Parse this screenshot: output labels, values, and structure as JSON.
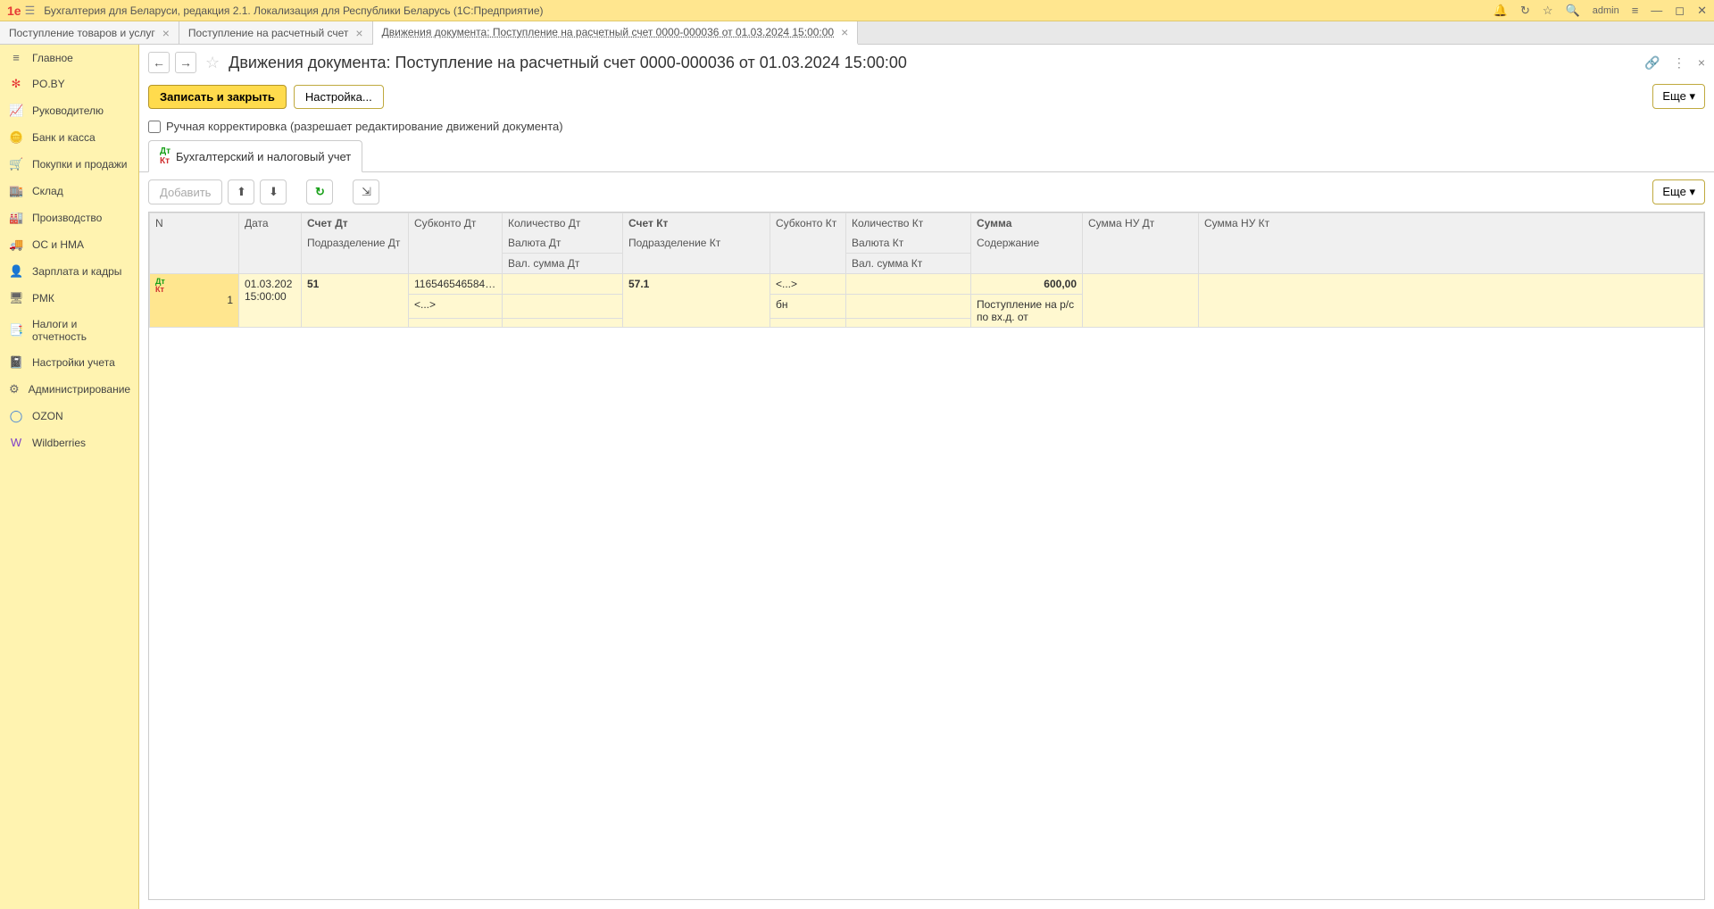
{
  "titlebar": {
    "title": "Бухгалтерия для Беларуси, редакция 2.1. Локализация для Республики Беларусь   (1С:Предприятие)",
    "user": "admin"
  },
  "tabs": [
    {
      "label": "Поступление товаров и услуг"
    },
    {
      "label": "Поступление на расчетный счет"
    },
    {
      "label": "Движения документа: Поступление на расчетный счет 0000-000036 от 01.03.2024 15:00:00"
    }
  ],
  "sidebar": {
    "items": [
      {
        "label": "Главное"
      },
      {
        "label": "PO.BY"
      },
      {
        "label": "Руководителю"
      },
      {
        "label": "Банк и касса"
      },
      {
        "label": "Покупки и продажи"
      },
      {
        "label": "Склад"
      },
      {
        "label": "Производство"
      },
      {
        "label": "ОС и НМА"
      },
      {
        "label": "Зарплата и кадры"
      },
      {
        "label": "РМК"
      },
      {
        "label": "Налоги и отчетность"
      },
      {
        "label": "Настройки учета"
      },
      {
        "label": "Администрирование"
      },
      {
        "label": "OZON"
      },
      {
        "label": "Wildberries"
      }
    ]
  },
  "doc": {
    "title": "Движения документа: Поступление на расчетный счет 0000-000036 от 01.03.2024 15:00:00"
  },
  "actions": {
    "save_close": "Записать и закрыть",
    "settings": "Настройка...",
    "more": "Еще"
  },
  "check": {
    "label": "Ручная корректировка (разрешает редактирование движений документа)"
  },
  "inner_tab": {
    "label": "Бухгалтерский и налоговый учет"
  },
  "table_toolbar": {
    "add": "Добавить",
    "more": "Еще"
  },
  "table": {
    "headers": {
      "n": "N",
      "date": "Дата",
      "acc_dt": "Счет Дт",
      "subrow_dt": "Подразделение Дт",
      "sub_dt": "Субконто Дт",
      "qty_dt": "Количество Дт",
      "cur_dt": "Валюта Дт",
      "valsum_dt": "Вал. сумма Дт",
      "acc_kt": "Счет Кт",
      "subrow_kt": "Подразделение Кт",
      "sub_kt": "Субконто Кт",
      "qty_kt": "Количество Кт",
      "cur_kt": "Валюта Кт",
      "valsum_kt": "Вал. сумма Кт",
      "sum": "Сумма",
      "content": "Содержание",
      "nu_dt": "Сумма НУ Дт",
      "nu_kt": "Сумма НУ Кт"
    },
    "row": {
      "n": "1",
      "date": "01.03.202 15:00:00",
      "acc_dt": "51",
      "sub_dt1": "116546546584…",
      "sub_dt2": "<...>",
      "acc_kt": "57.1",
      "sub_kt1": "<...>",
      "sub_kt2": "бн",
      "sum": "600,00",
      "content": "Поступление на р/с по вх.д. от"
    }
  }
}
